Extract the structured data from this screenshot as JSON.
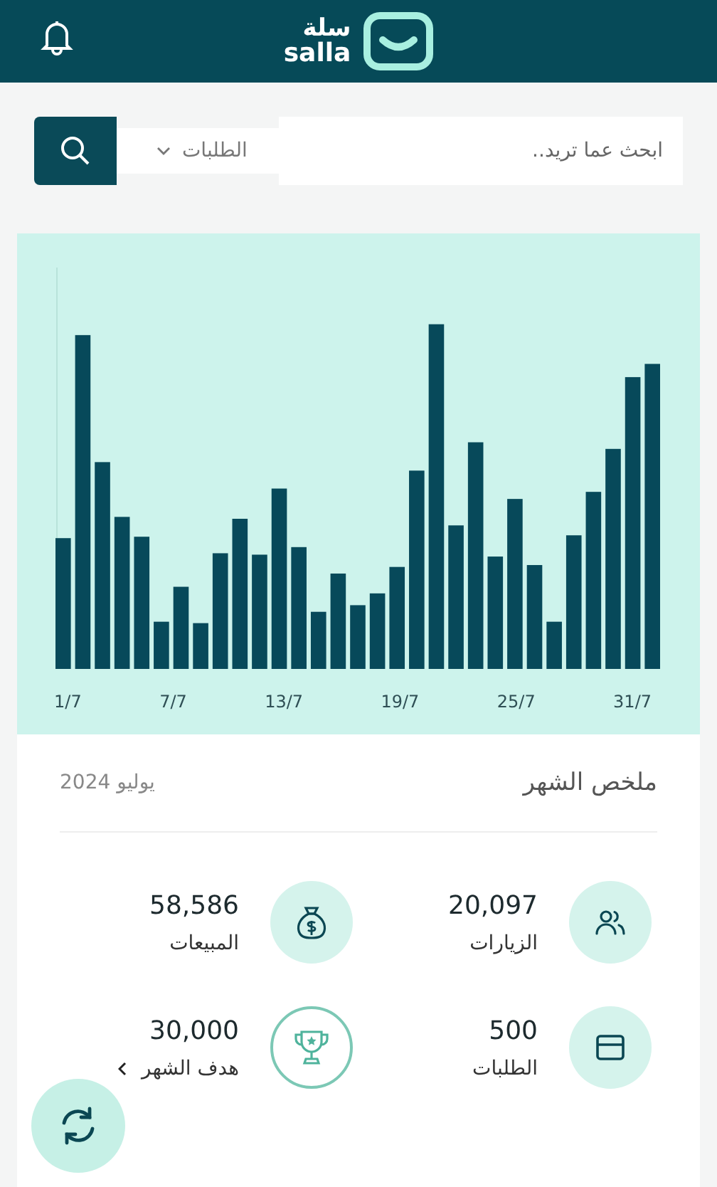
{
  "header": {
    "logo_arabic": "سلة",
    "logo_latin": "salla"
  },
  "search": {
    "placeholder": "ابحث عما تريد..",
    "scope": "الطلبات"
  },
  "chart": {
    "x_labels": [
      "31/7",
      "25/7",
      "19/7",
      "13/7",
      "7/7",
      "1/7"
    ]
  },
  "summary": {
    "title": "ملخص الشهر",
    "period": "يوليو 2024",
    "stats": [
      {
        "kind": "visits",
        "value": "20,097",
        "label": "الزيارات"
      },
      {
        "kind": "sales",
        "value": "58,586",
        "label": "المبيعات"
      },
      {
        "kind": "orders",
        "value": "500",
        "label": "الطلبات"
      },
      {
        "kind": "goal",
        "value": "30,000",
        "label": "هدف الشهر",
        "link": true
      }
    ]
  }
}
